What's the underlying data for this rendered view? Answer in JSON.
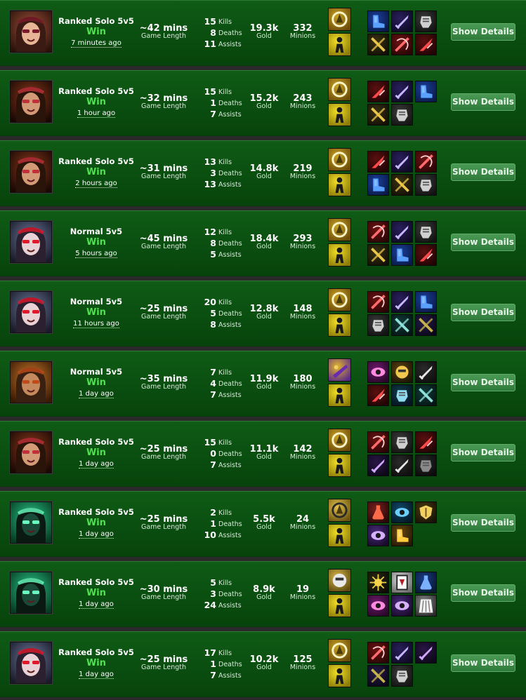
{
  "labels": {
    "game_length": "Game Length",
    "kills": "Kills",
    "deaths": "Deaths",
    "assists": "Assists",
    "gold": "Gold",
    "minions": "Minions",
    "show_details": "Show Details"
  },
  "colors": {
    "row_background": "#0a4e10",
    "win_text": "#4fe14f",
    "details_button": "#3a8a45"
  },
  "matches": [
    {
      "champion_icon": "champion-portrait-red-hat-sniper-icon",
      "type": "Ranked Solo 5v5",
      "result": "Win",
      "ago": "7 minutes ago",
      "length": "~42 mins",
      "kills": "15",
      "deaths": "8",
      "assists": "11",
      "gold": "19.3k",
      "minions": "332",
      "spells": [
        "heal-spell-icon",
        "flash-spell-icon"
      ],
      "items": [
        "blue-boots-icon",
        "purple-sword-icon",
        "grey-shield-icon",
        "gold-cross-sword-icon",
        "red-crossbow-icon",
        "red-blade-icon"
      ]
    },
    {
      "champion_icon": "champion-portrait-brunette-shouting-icon",
      "type": "Ranked Solo 5v5",
      "result": "Win",
      "ago": "1 hour ago",
      "length": "~32 mins",
      "kills": "15",
      "deaths": "1",
      "assists": "7",
      "gold": "15.2k",
      "minions": "243",
      "spells": [
        "heal-spell-icon",
        "flash-spell-icon"
      ],
      "items": [
        "red-blade-icon",
        "purple-sword-icon",
        "blue-boots-icon",
        "gold-cross-sword-icon",
        "grey-gauntlet-icon"
      ]
    },
    {
      "champion_icon": "champion-portrait-brunette-shouting-icon",
      "type": "Ranked Solo 5v5",
      "result": "Win",
      "ago": "2 hours ago",
      "length": "~31 mins",
      "kills": "13",
      "deaths": "3",
      "assists": "13",
      "gold": "14.8k",
      "minions": "219",
      "spells": [
        "heal-spell-icon",
        "flash-spell-icon"
      ],
      "items": [
        "red-blade-icon",
        "purple-sword-icon",
        "red-crossbow-icon",
        "blue-boots-icon",
        "gold-cross-sword-icon",
        "grey-shield-icon"
      ]
    },
    {
      "champion_icon": "champion-portrait-pale-red-glasses-icon",
      "type": "Normal 5v5",
      "result": "Win",
      "ago": "5 hours ago",
      "length": "~45 mins",
      "kills": "12",
      "deaths": "8",
      "assists": "5",
      "gold": "18.4k",
      "minions": "293",
      "spells": [
        "heal-spell-icon",
        "flash-spell-icon"
      ],
      "items": [
        "red-crossbow-icon",
        "purple-sword-icon",
        "grey-shield-icon",
        "gold-cross-sword-icon",
        "blue-boots-icon",
        "red-blade-icon"
      ]
    },
    {
      "champion_icon": "champion-portrait-pale-red-glasses-icon",
      "type": "Normal 5v5",
      "result": "Win",
      "ago": "11 hours ago",
      "length": "~25 mins",
      "kills": "20",
      "deaths": "5",
      "assists": "8",
      "gold": "12.8k",
      "minions": "148",
      "spells": [
        "heal-spell-icon",
        "flash-spell-icon"
      ],
      "items": [
        "red-crossbow-icon",
        "purple-sword-icon",
        "blue-boots-icon",
        "grey-shield-icon",
        "teal-scythe-icon",
        "purple-cross-sword-icon"
      ]
    },
    {
      "champion_icon": "champion-portrait-red-bandana-gunner-icon",
      "type": "Normal 5v5",
      "result": "Win",
      "ago": "1 day ago",
      "length": "~35 mins",
      "kills": "7",
      "deaths": "4",
      "assists": "7",
      "gold": "11.9k",
      "minions": "180",
      "spells": [
        "purple-ghost-spell-icon",
        "flash-spell-icon"
      ],
      "items": [
        "pink-eye-icon",
        "gold-helmet-icon",
        "silver-sword-icon",
        "red-blade-icon",
        "teal-hammer-icon",
        "teal-scythe-icon"
      ]
    },
    {
      "champion_icon": "champion-portrait-brunette-shouting-icon",
      "type": "Ranked Solo 5v5",
      "result": "Win",
      "ago": "1 day ago",
      "length": "~25 mins",
      "kills": "15",
      "deaths": "0",
      "assists": "7",
      "gold": "11.1k",
      "minions": "142",
      "spells": [
        "heal-spell-icon",
        "flash-spell-icon"
      ],
      "items": [
        "red-crossbow-icon",
        "grey-gauntlet-icon",
        "red-blade-icon",
        "purple-dagger-icon",
        "silver-sword-icon",
        "black-gauntlet-icon"
      ]
    },
    {
      "champion_icon": "champion-portrait-green-wraith-icon",
      "type": "Ranked Solo 5v5",
      "result": "Win",
      "ago": "1 day ago",
      "length": "~25 mins",
      "kills": "2",
      "deaths": "1",
      "assists": "10",
      "gold": "5.5k",
      "minions": "24",
      "spells": [
        "gold-ignite-spell-icon",
        "flash-spell-icon"
      ],
      "items": [
        "red-potion-icon",
        "blue-eye-ward-icon",
        "gold-shield-icon",
        "purple-orb-icon",
        "gold-boots-icon"
      ]
    },
    {
      "champion_icon": "champion-portrait-green-wraith-icon",
      "type": "Ranked Solo 5v5",
      "result": "Win",
      "ago": "1 day ago",
      "length": "~30 mins",
      "kills": "5",
      "deaths": "3",
      "assists": "24",
      "gold": "8.9k",
      "minions": "19",
      "spells": [
        "gold-exhaust-spell-icon",
        "flash-spell-icon"
      ],
      "items": [
        "gold-sunburst-icon",
        "silver-card-icon",
        "blue-flask-icon",
        "pink-eye-icon",
        "purple-orb-icon",
        "silver-cape-icon"
      ]
    },
    {
      "champion_icon": "champion-portrait-pale-red-glasses-icon",
      "type": "Ranked Solo 5v5",
      "result": "Win",
      "ago": "1 day ago",
      "length": "~25 mins",
      "kills": "17",
      "deaths": "1",
      "assists": "7",
      "gold": "10.2k",
      "minions": "125",
      "spells": [
        "heal-spell-icon",
        "flash-spell-icon"
      ],
      "items": [
        "red-crossbow-icon",
        "purple-sword-icon",
        "purple-dagger-icon",
        "purple-cross-sword-icon",
        "grey-gauntlet-icon"
      ]
    }
  ]
}
